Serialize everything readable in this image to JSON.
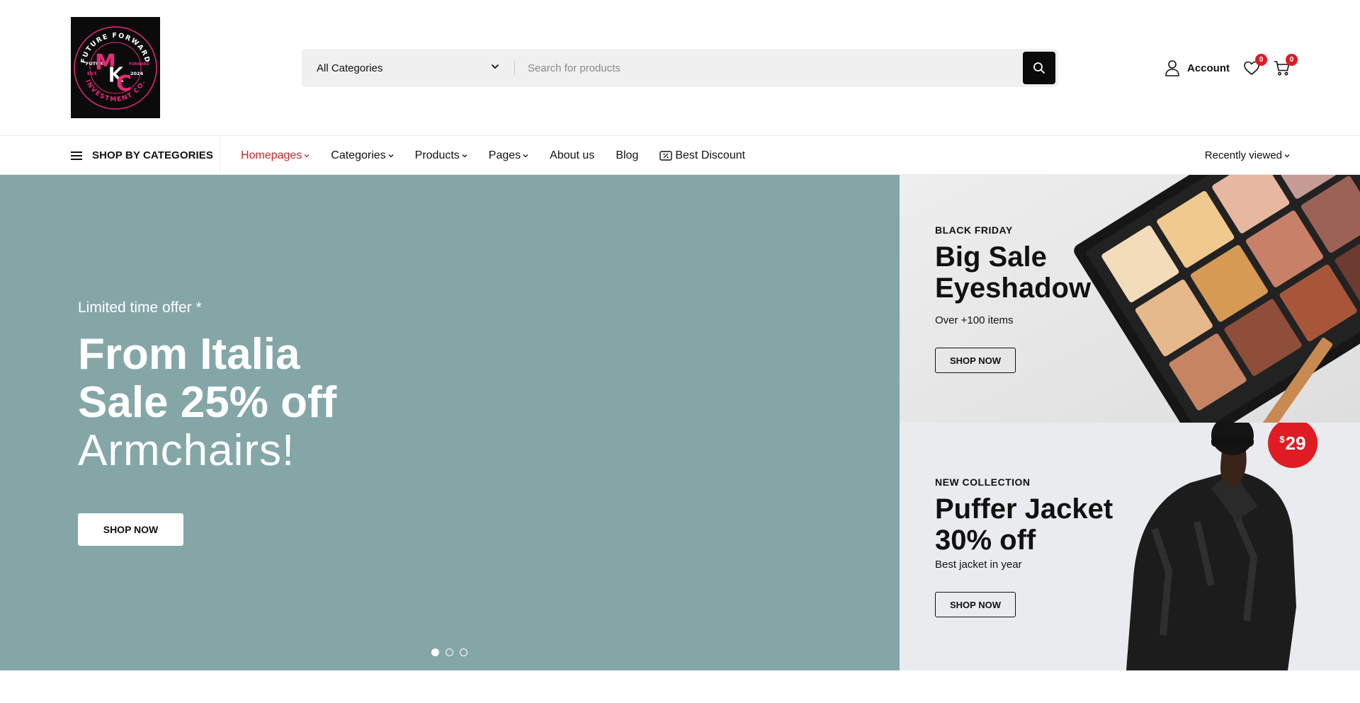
{
  "header": {
    "logo": {
      "top_arc_text": "FUTURE FORWARD",
      "bottom_arc_text": "INVESTMENT CO.",
      "monogram": "MKC",
      "left_text_1": "FUTURE",
      "left_text_2": "EST.",
      "right_text_1": "FORWARD",
      "right_text_2": "2024"
    },
    "search": {
      "category": "All Categories",
      "placeholder": "Search for products"
    },
    "account_label": "Account",
    "wishlist_count": "0",
    "cart_count": "0"
  },
  "nav": {
    "shop_by_categories": "SHOP BY CATEGORIES",
    "items": [
      {
        "label": "Homepages"
      },
      {
        "label": "Categories"
      },
      {
        "label": "Products"
      },
      {
        "label": "Pages"
      },
      {
        "label": "About us"
      },
      {
        "label": "Blog"
      },
      {
        "label": "Best Discount"
      }
    ],
    "recently_viewed": "Recently viewed"
  },
  "hero": {
    "offer": "Limited time offer *",
    "title_line1": "From Italia",
    "title_line2": "Sale 25% off",
    "subtitle": "Armchairs!",
    "button": "SHOP NOW",
    "slides": 3,
    "active_slide": 1
  },
  "banners": [
    {
      "eyebrow": "BLACK FRIDAY",
      "title_line1": "Big Sale",
      "title_line2": "Eyeshadow",
      "desc": "Over +100 items",
      "button": "SHOP NOW"
    },
    {
      "eyebrow": "NEW COLLECTION",
      "title_line1": "Puffer Jacket",
      "title_line2": "30% off",
      "desc": "Best jacket in year",
      "button": "SHOP NOW",
      "price_currency": "$",
      "price_amount": "29"
    }
  ],
  "colors": {
    "accent_red": "#e01b24",
    "active_nav": "#d0212a",
    "hero_bg": "#84a6a7",
    "logo_pink": "#e8297a"
  }
}
